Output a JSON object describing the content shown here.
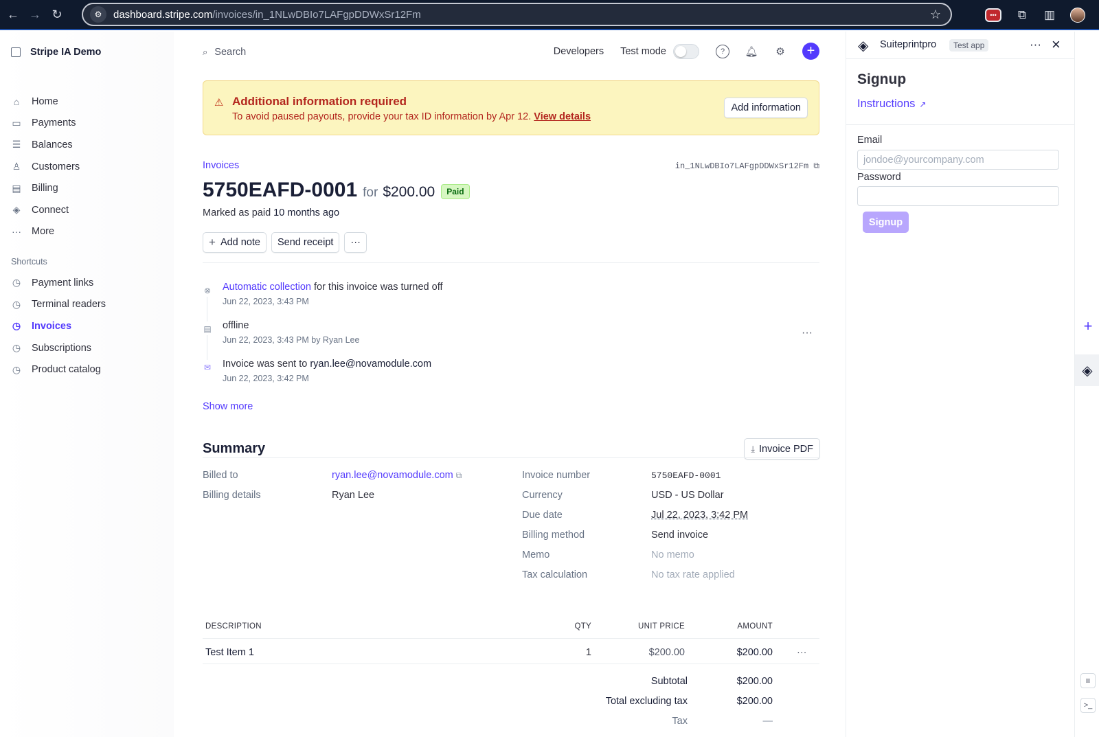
{
  "browser": {
    "url_host": "dashboard.stripe.com",
    "url_path": "/invoices/in_1NLwDBIo7LAFgpDDWxSr12Fm"
  },
  "sidebar": {
    "account_name": "Stripe IA Demo",
    "items": [
      {
        "label": "Home",
        "icon": "home-icon"
      },
      {
        "label": "Payments",
        "icon": "payments-icon"
      },
      {
        "label": "Balances",
        "icon": "balances-icon"
      },
      {
        "label": "Customers",
        "icon": "customers-icon"
      },
      {
        "label": "Billing",
        "icon": "billing-icon"
      },
      {
        "label": "Connect",
        "icon": "connect-icon"
      },
      {
        "label": "More",
        "icon": "more-icon"
      }
    ],
    "shortcuts_title": "Shortcuts",
    "shortcuts": [
      {
        "label": "Payment links"
      },
      {
        "label": "Terminal readers"
      },
      {
        "label": "Invoices",
        "active": true
      },
      {
        "label": "Subscriptions"
      },
      {
        "label": "Product catalog"
      }
    ]
  },
  "topbar": {
    "search_label": "Search",
    "developers": "Developers",
    "test_mode": "Test mode"
  },
  "banner": {
    "title": "Additional information required",
    "message": "To avoid paused payouts, provide your tax ID information by Apr 12.",
    "link": "View details",
    "button": "Add information"
  },
  "invoice": {
    "breadcrumb": "Invoices",
    "id": "in_1NLwDBIo7LAFgpDDWxSr12Fm",
    "number": "5750EAFD-0001",
    "for_text": "for",
    "amount": "$200.00",
    "status": "Paid",
    "marked_prefix": "Marked as paid",
    "marked_when": "10 months ago",
    "actions": {
      "add_note": "Add note",
      "send_receipt": "Send receipt",
      "more": "···"
    }
  },
  "timeline": {
    "items": [
      {
        "link": "Automatic collection",
        "text": " for this invoice was turned off",
        "time": "Jun 22, 2023, 3:43 PM"
      },
      {
        "text": "offline",
        "time": "Jun 22, 2023, 3:43 PM by Ryan Lee"
      },
      {
        "text": "Invoice was sent to ",
        "strong": "ryan.lee@novamodule.com",
        "time": "Jun 22, 2023, 3:42 PM"
      }
    ],
    "show_more": "Show more"
  },
  "summary": {
    "title": "Summary",
    "pdf_button": "Invoice PDF",
    "left": [
      {
        "label": "Billed to",
        "value": "ryan.lee@novamodule.com"
      },
      {
        "label": "Billing details",
        "value": "Ryan Lee"
      }
    ],
    "right": [
      {
        "label": "Invoice number",
        "value": "5750EAFD-0001"
      },
      {
        "label": "Currency",
        "value": "USD - US Dollar"
      },
      {
        "label": "Due date",
        "value": "Jul 22, 2023, 3:42 PM"
      },
      {
        "label": "Billing method",
        "value": "Send invoice"
      },
      {
        "label": "Memo",
        "value": "No memo"
      },
      {
        "label": "Tax calculation",
        "value": "No tax rate applied"
      }
    ]
  },
  "line_items": {
    "headers": {
      "description": "DESCRIPTION",
      "qty": "QTY",
      "unit_price": "UNIT PRICE",
      "amount": "AMOUNT"
    },
    "rows": [
      {
        "description": "Test Item 1",
        "qty": "1",
        "unit_price": "$200.00",
        "amount": "$200.00"
      }
    ],
    "totals": [
      {
        "label": "Subtotal",
        "value": "$200.00"
      },
      {
        "label": "Total excluding tax",
        "value": "$200.00"
      },
      {
        "label": "Tax",
        "value": "—"
      }
    ]
  },
  "app_panel": {
    "app_name": "Suiteprintpro",
    "tag": "Test app",
    "title": "Signup",
    "instructions": "Instructions",
    "email_label": "Email",
    "email_placeholder": "jondoe@yourcompany.com",
    "password_label": "Password",
    "signup_button": "Signup"
  },
  "colors": {
    "accent": "#533afd",
    "banner_bg": "#fcf5bf",
    "paid_badge": "#d7f7c2"
  }
}
